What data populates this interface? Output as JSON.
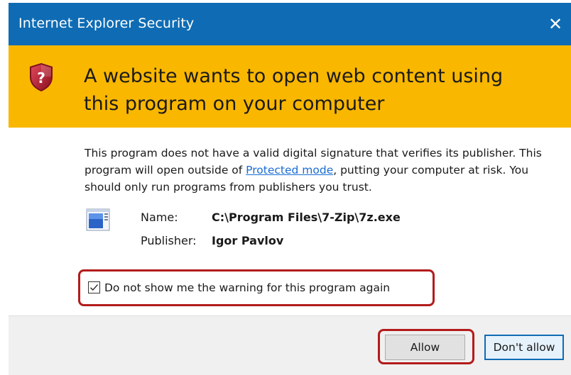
{
  "dialog": {
    "title": "Internet Explorer Security",
    "close_glyph": "✕",
    "headline": "A website wants to open web content using this program on your computer",
    "description_part1": "This program does not have a valid digital signature that verifies its publisher. This program will open outside of ",
    "protected_mode_link": "Protected mode",
    "description_part2": ", putting your computer at risk. You should only run programs from publishers you trust.",
    "name_label": "Name:",
    "name_value": "C:\\Program Files\\7-Zip\\7z.exe",
    "publisher_label": "Publisher:",
    "publisher_value": "Igor Pavlov",
    "checkbox_label": "Do not show me the warning for this program again",
    "checkbox_checked": true,
    "allow_button": "Allow",
    "deny_button": "Don't allow"
  },
  "colors": {
    "titlebar": "#0f6cb4",
    "banner": "#f9b700",
    "highlight": "#b31b1b",
    "link": "#1a6dd1"
  }
}
